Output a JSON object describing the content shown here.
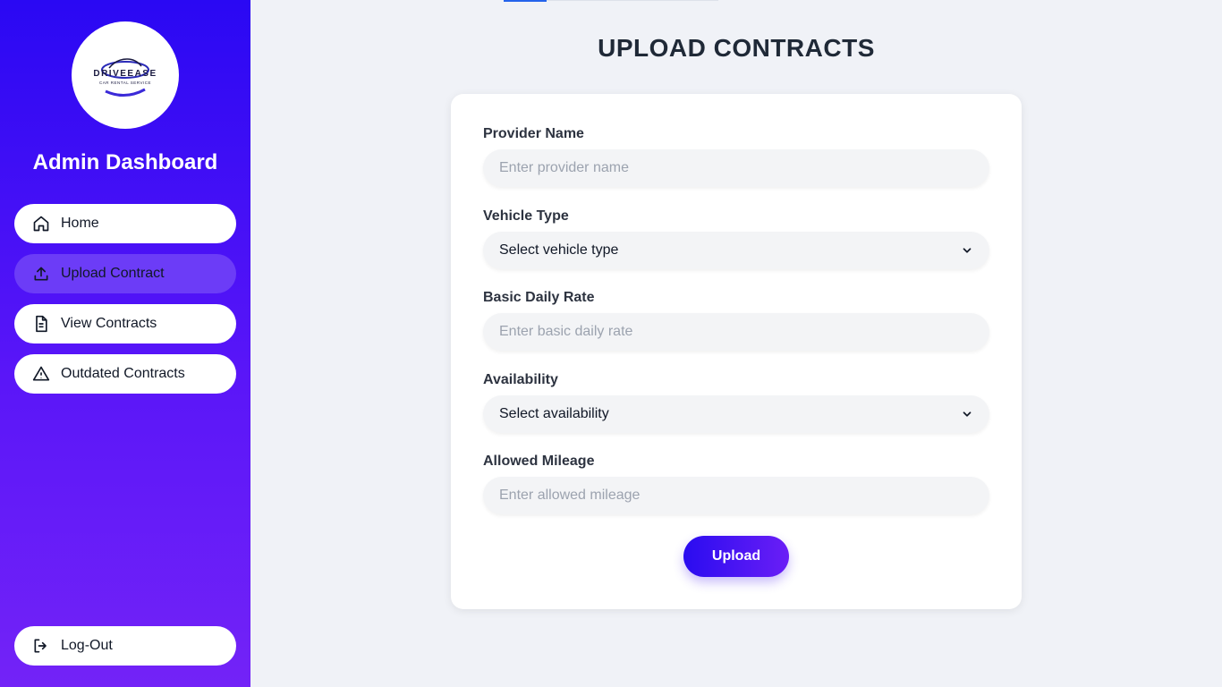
{
  "sidebar": {
    "logo": {
      "brand": "DRIVEEASE",
      "tagline": "CAR RENTAL SERVICE"
    },
    "title": "Admin Dashboard",
    "items": [
      {
        "label": "Home",
        "icon": "home-icon"
      },
      {
        "label": "Upload Contract",
        "icon": "upload-icon",
        "active": true
      },
      {
        "label": "View Contracts",
        "icon": "document-icon"
      },
      {
        "label": "Outdated Contracts",
        "icon": "warning-icon"
      }
    ],
    "logout": {
      "label": "Log-Out",
      "icon": "logout-icon"
    }
  },
  "main": {
    "title": "UPLOAD CONTRACTS",
    "form": {
      "provider_name": {
        "label": "Provider Name",
        "placeholder": "Enter provider name",
        "value": ""
      },
      "vehicle_type": {
        "label": "Vehicle Type",
        "selected": "Select vehicle type"
      },
      "basic_daily_rate": {
        "label": "Basic Daily Rate",
        "placeholder": "Enter basic daily rate",
        "value": ""
      },
      "availability": {
        "label": "Availability",
        "selected": "Select availability"
      },
      "allowed_mileage": {
        "label": "Allowed Mileage",
        "placeholder": "Enter allowed mileage",
        "value": ""
      },
      "submit_label": "Upload"
    }
  },
  "colors": {
    "sidebar_top": "#2a08f3",
    "sidebar_bottom": "#7323f7",
    "active_item": "#6c3cf7",
    "page_bg": "#f0f2f7",
    "button_start": "#2a0cf0",
    "button_end": "#6a1ef6"
  }
}
